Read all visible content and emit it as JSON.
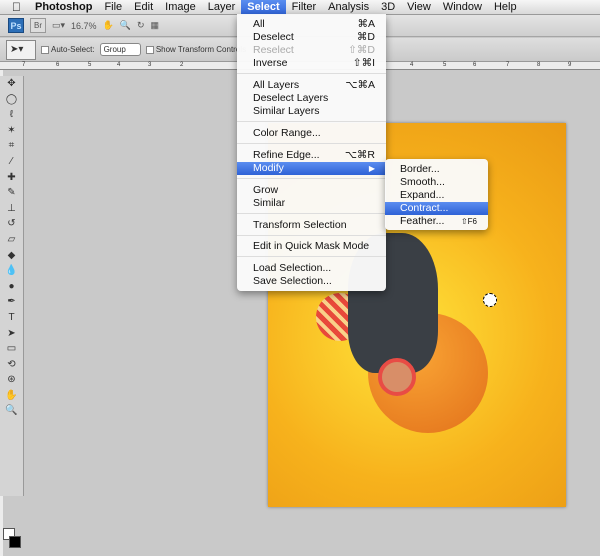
{
  "menubar": {
    "apple": "",
    "app": "Photoshop",
    "items": [
      "File",
      "Edit",
      "Image",
      "Layer",
      "Select",
      "Filter",
      "Analysis",
      "3D",
      "View",
      "Window",
      "Help"
    ],
    "active": "Select"
  },
  "appbar": {
    "ps": "Ps",
    "br": "Br",
    "zoom": "16.7%"
  },
  "options": {
    "auto_select_label": "Auto-Select:",
    "auto_select_value": "Group",
    "show_transform_label": "Show Transform Controls"
  },
  "ruler": {
    "ticks": [
      "7",
      "6",
      "5",
      "4",
      "3",
      "2",
      "4",
      "5",
      "6",
      "7",
      "8",
      "9"
    ]
  },
  "select_menu": {
    "items": [
      {
        "label": "All",
        "shortcut": "⌘A"
      },
      {
        "label": "Deselect",
        "shortcut": "⌘D"
      },
      {
        "label": "Reselect",
        "shortcut": "⇧⌘D",
        "disabled": true
      },
      {
        "label": "Inverse",
        "shortcut": "⇧⌘I"
      },
      {
        "label": "All Layers",
        "shortcut": "⌥⌘A"
      },
      {
        "label": "Deselect Layers",
        "shortcut": ""
      },
      {
        "label": "Similar Layers",
        "shortcut": ""
      },
      {
        "label": "Color Range...",
        "shortcut": ""
      },
      {
        "label": "Refine Edge...",
        "shortcut": "⌥⌘R"
      },
      {
        "label": "Modify",
        "shortcut": "▶",
        "highlighted": true
      },
      {
        "label": "Grow",
        "shortcut": ""
      },
      {
        "label": "Similar",
        "shortcut": ""
      },
      {
        "label": "Transform Selection",
        "shortcut": ""
      },
      {
        "label": "Edit in Quick Mask Mode",
        "shortcut": ""
      },
      {
        "label": "Load Selection...",
        "shortcut": ""
      },
      {
        "label": "Save Selection...",
        "shortcut": ""
      }
    ]
  },
  "modify_submenu": {
    "items": [
      {
        "label": "Border...",
        "shortcut": ""
      },
      {
        "label": "Smooth...",
        "shortcut": ""
      },
      {
        "label": "Expand...",
        "shortcut": ""
      },
      {
        "label": "Contract...",
        "shortcut": "",
        "highlighted": true
      },
      {
        "label": "Feather...",
        "shortcut": "⇧F6"
      }
    ]
  },
  "colors": {
    "highlight": "#3a6fe0",
    "canvas_bg": "#c9c9c9"
  }
}
